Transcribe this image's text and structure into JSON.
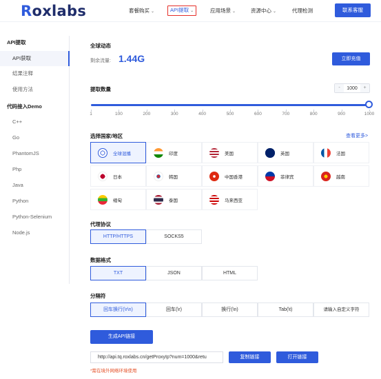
{
  "header": {
    "logo_initial": "R",
    "logo_rest": "oxlabs",
    "nav": [
      {
        "label": "套餐购买",
        "chevron": "⌄"
      },
      {
        "label": "API提取",
        "chevron": "⌄"
      },
      {
        "label": "应用场景",
        "chevron": "⌄"
      },
      {
        "label": "资源中心",
        "chevron": "⌄"
      },
      {
        "label": "代理检测",
        "chevron": ""
      }
    ],
    "contact_label": "联系客服"
  },
  "sidebar": {
    "group1_title": "API提取",
    "group1_items": [
      "API获取",
      "结果注释",
      "使用方法"
    ],
    "group2_title": "代码接入Demo",
    "group2_items": [
      "C++",
      "Go",
      "PhantomJS",
      "Php",
      "Java",
      "Python",
      "Python-Selenium",
      "Node.js"
    ]
  },
  "traffic": {
    "title": "全球动态",
    "remaining_label": "剩余流量:",
    "remaining_value": "1.44G",
    "recharge_label": "立即充值"
  },
  "quantity": {
    "title": "提取数量",
    "minus": "-",
    "value": "1000",
    "plus": "+",
    "slider_value": 1000,
    "slider_max": 1000,
    "ticks": [
      "1",
      "100",
      "200",
      "300",
      "400",
      "500",
      "600",
      "700",
      "800",
      "900",
      "1000"
    ]
  },
  "region": {
    "title": "选择国家/地区",
    "more_label": "查看更多>",
    "items": [
      {
        "label": "全球混播",
        "flag": "globe-icon"
      },
      {
        "label": "印度",
        "flag": "india-flag-icon"
      },
      {
        "label": "美国",
        "flag": "usa-flag-icon"
      },
      {
        "label": "英国",
        "flag": "uk-flag-icon"
      },
      {
        "label": "法国",
        "flag": "france-flag-icon"
      },
      {
        "label": "日本",
        "flag": "japan-flag-icon"
      },
      {
        "label": "韩国",
        "flag": "korea-flag-icon"
      },
      {
        "label": "中国香港",
        "flag": "hongkong-flag-icon"
      },
      {
        "label": "菲律宾",
        "flag": "philippines-flag-icon"
      },
      {
        "label": "越南",
        "flag": "vietnam-flag-icon"
      },
      {
        "label": "缅甸",
        "flag": "myanmar-flag-icon"
      },
      {
        "label": "泰国",
        "flag": "thailand-flag-icon"
      },
      {
        "label": "马来西亚",
        "flag": "malaysia-flag-icon"
      }
    ]
  },
  "protocol": {
    "title": "代理协议",
    "options": [
      "HTTP/HTTPS",
      "SOCKS5"
    ]
  },
  "format": {
    "title": "数据格式",
    "options": [
      "TXT",
      "JSON",
      "HTML"
    ]
  },
  "separator": {
    "title": "分隔符",
    "options": [
      "回车换行(\\r\\n)",
      "回车(\\r)",
      "换行(\\n)",
      "Tab(\\t)"
    ],
    "custom_placeholder": "请输入自定义字符"
  },
  "generate": {
    "button_label": "生成API链接",
    "url_value": "http://api.tq.roxlabs.cn/getProxyIp?num=1000&retu",
    "copy_label": "复制链接",
    "open_label": "打开链接",
    "note": "*需在境外网络环境使用"
  },
  "colors": {
    "accent": "#2f5bdc",
    "highlight_border": "#e52d27",
    "note_text": "#e5542c"
  }
}
